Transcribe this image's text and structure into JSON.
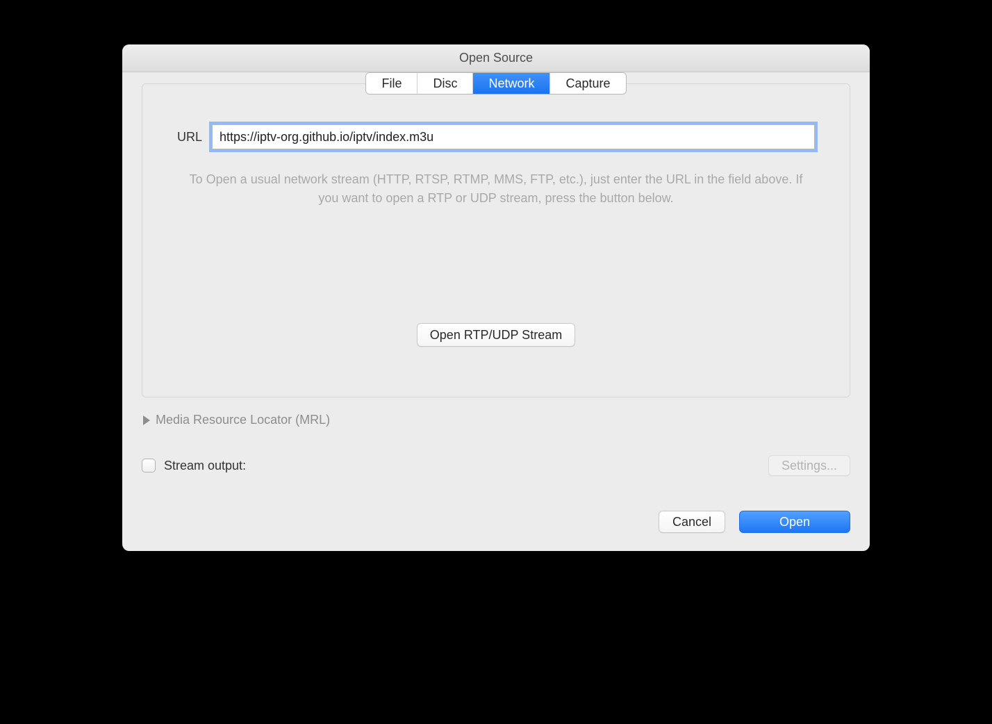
{
  "window": {
    "title": "Open Source"
  },
  "tabs": {
    "file": "File",
    "disc": "Disc",
    "network": "Network",
    "capture": "Capture",
    "active": "network"
  },
  "networkPanel": {
    "url_label": "URL",
    "url_value": "https://iptv-org.github.io/iptv/index.m3u",
    "help_text": "To Open a usual network stream (HTTP, RTSP, RTMP, MMS, FTP, etc.), just enter the URL in the field above. If you want to open a RTP or UDP stream, press the button below.",
    "rtp_button": "Open RTP/UDP Stream"
  },
  "mrl": {
    "label": "Media Resource Locator (MRL)"
  },
  "streamOutput": {
    "label": "Stream output:",
    "checked": false,
    "settings_label": "Settings..."
  },
  "footer": {
    "cancel": "Cancel",
    "open": "Open"
  }
}
